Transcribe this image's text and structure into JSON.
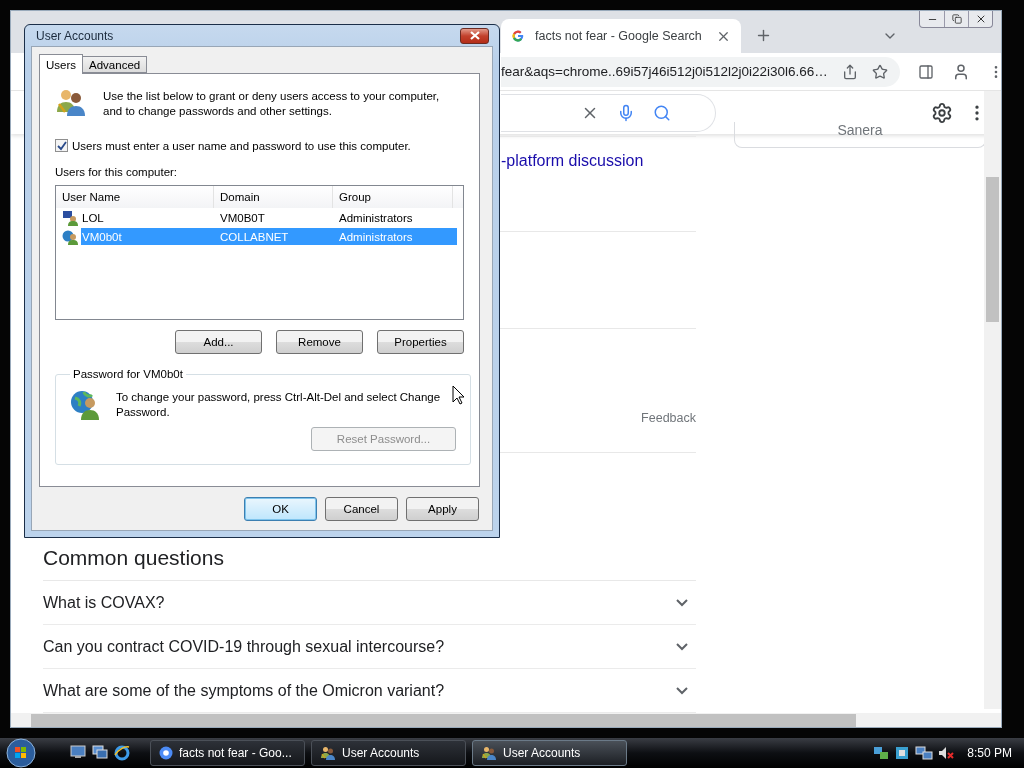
{
  "browser": {
    "tab": {
      "title": "facts not fear - Google Search",
      "selected": true
    },
    "address": "fear&aqs=chrome..69i57j46i512j0i512l2j0i22i30l6.66…",
    "side_card": "Sanera",
    "link": "-platform discussion",
    "feedback": "Feedback",
    "questions_heading": "Common questions",
    "questions": [
      {
        "text": "What is COVAX?",
        "expanded": false
      },
      {
        "text": "Can you contract COVID-19 through sexual intercourse?",
        "expanded": false
      },
      {
        "text": "What are some of the symptoms of the Omicron variant?",
        "expanded": false
      }
    ]
  },
  "dialog": {
    "title": "User Accounts",
    "tabs": [
      {
        "label": "Users",
        "selected": true
      },
      {
        "label": "Advanced",
        "selected": false
      }
    ],
    "intro": "Use the list below to grant or deny users access to your computer, and to change passwords and other settings.",
    "require_login": {
      "label": "Users must enter a user name and password to use this computer.",
      "checked": true
    },
    "list_label": "Users for this computer:",
    "columns": [
      "User Name",
      "Domain",
      "Group"
    ],
    "rows": [
      {
        "user": "LOL",
        "domain": "VM0B0T",
        "group": "Administrators",
        "kind": "local",
        "selected": false
      },
      {
        "user": "VM0b0t",
        "domain": "COLLABNET",
        "group": "Administrators",
        "kind": "domain",
        "selected": true
      }
    ],
    "list_buttons": [
      {
        "label": "Add...",
        "disabled": false
      },
      {
        "label": "Remove",
        "disabled": false
      },
      {
        "label": "Properties",
        "disabled": false
      }
    ],
    "password_group": {
      "title": "Password for VM0b0t",
      "text": "To change your password, press Ctrl-Alt-Del and select Change Password.",
      "button": {
        "label": "Reset Password...",
        "disabled": true
      }
    },
    "buttons": [
      {
        "label": "OK",
        "default": true
      },
      {
        "label": "Cancel",
        "default": false
      },
      {
        "label": "Apply",
        "default": false
      }
    ]
  },
  "taskbar": {
    "tasks": [
      {
        "label": "facts not fear - Goo...",
        "kind": "browser",
        "selected": false
      },
      {
        "label": "User Accounts",
        "kind": "users",
        "selected": false
      },
      {
        "label": "User Accounts",
        "kind": "users",
        "selected": true
      }
    ],
    "clock": "8:50 PM"
  }
}
